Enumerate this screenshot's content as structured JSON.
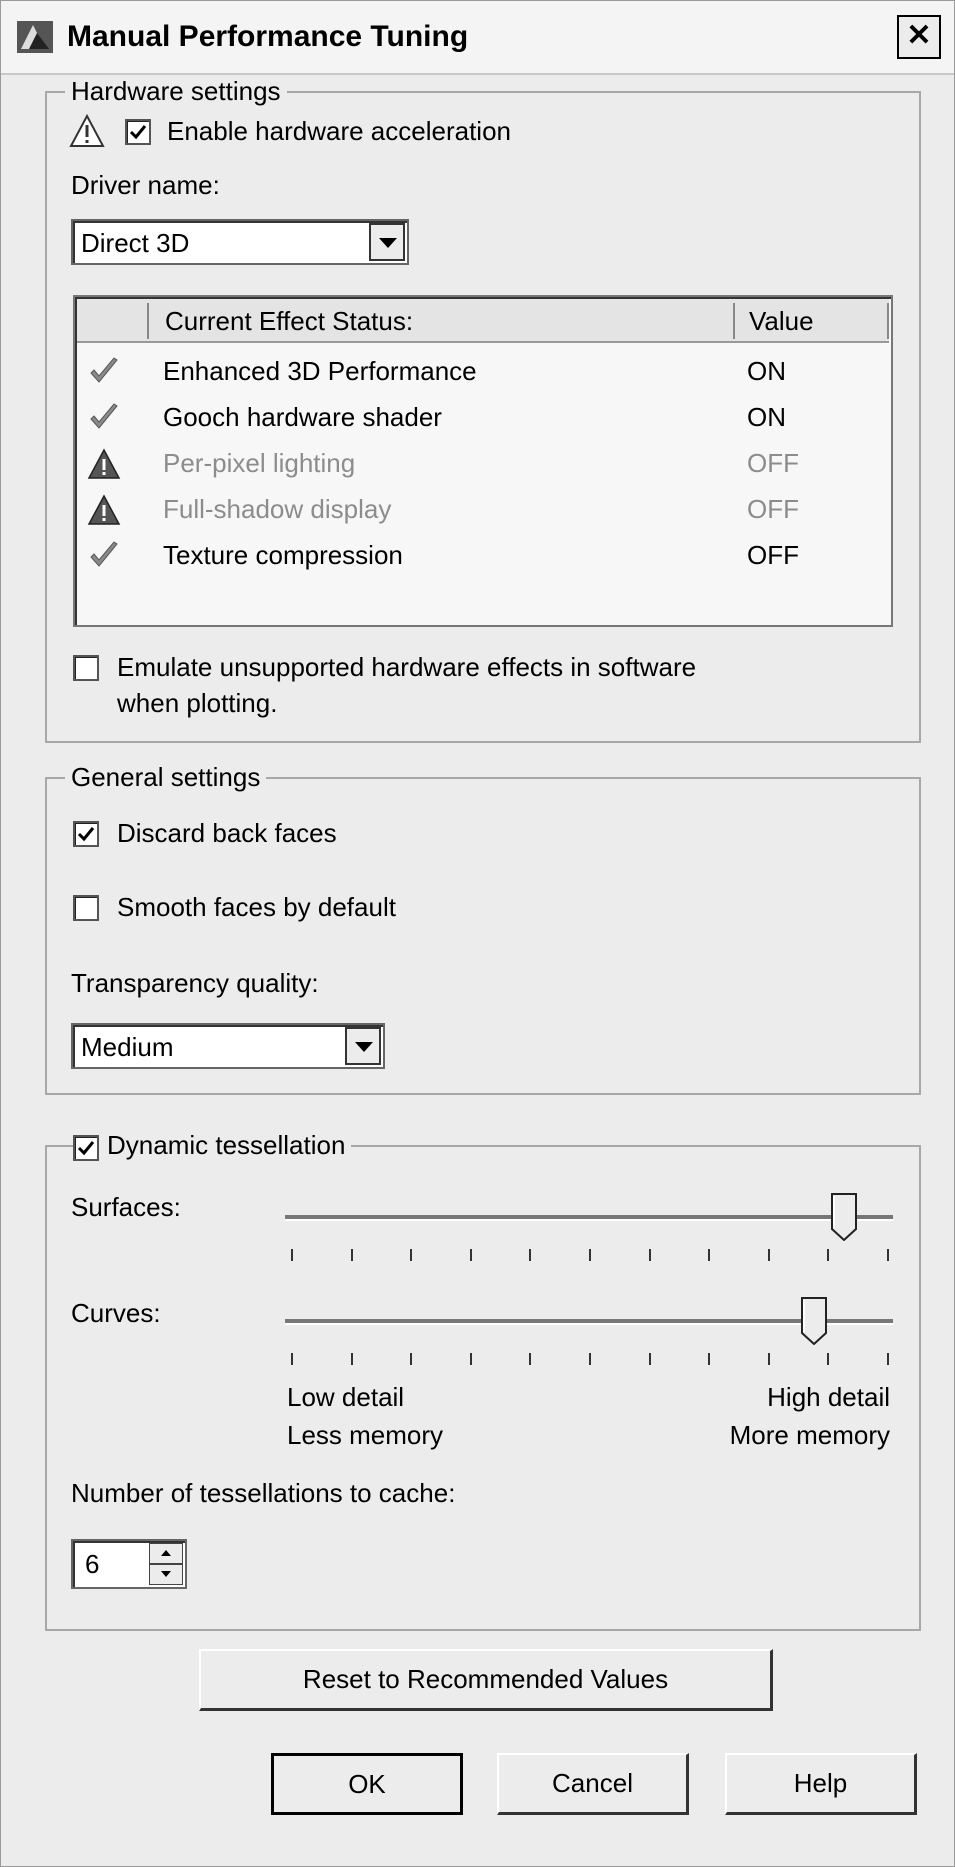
{
  "window": {
    "title": "Manual Performance Tuning",
    "close_glyph": "✕"
  },
  "hardware": {
    "legend": "Hardware settings",
    "enable_accel": {
      "label": "Enable hardware acceleration",
      "checked": true
    },
    "driver_label": "Driver name:",
    "driver_value": "Direct 3D",
    "effects_table": {
      "col_status": "Current Effect Status:",
      "col_value": "Value",
      "rows": [
        {
          "icon": "check-icon",
          "name": "Enhanced 3D Performance",
          "value": "ON",
          "dimmed": false
        },
        {
          "icon": "check-icon",
          "name": "Gooch hardware shader",
          "value": "ON",
          "dimmed": false
        },
        {
          "icon": "warning-icon",
          "name": "Per-pixel lighting",
          "value": "OFF",
          "dimmed": true
        },
        {
          "icon": "warning-icon",
          "name": "Full-shadow display",
          "value": "OFF",
          "dimmed": true
        },
        {
          "icon": "check-icon",
          "name": "Texture compression",
          "value": "OFF",
          "dimmed": false
        }
      ]
    },
    "emulate": {
      "label_line1": "Emulate unsupported hardware effects in software",
      "label_line2": "when plotting.",
      "checked": false
    }
  },
  "general": {
    "legend": "General settings",
    "discard_back_faces": {
      "label": "Discard back faces",
      "checked": true
    },
    "smooth_faces": {
      "label": "Smooth faces by default",
      "checked": false
    },
    "transparency_label": "Transparency quality:",
    "transparency_value": "Medium"
  },
  "tessellation": {
    "legend": "Dynamic tessellation",
    "enabled": true,
    "surfaces_label": "Surfaces:",
    "surfaces_level_fraction": 0.92,
    "curves_label": "Curves:",
    "curves_level_fraction": 0.87,
    "low_line1": "Low detail",
    "low_line2": "Less memory",
    "high_line1": "High detail",
    "high_line2": "More memory",
    "cache_label": "Number of tessellations to cache:",
    "cache_value": "6"
  },
  "buttons": {
    "reset": "Reset to Recommended Values",
    "ok": "OK",
    "cancel": "Cancel",
    "help": "Help"
  }
}
